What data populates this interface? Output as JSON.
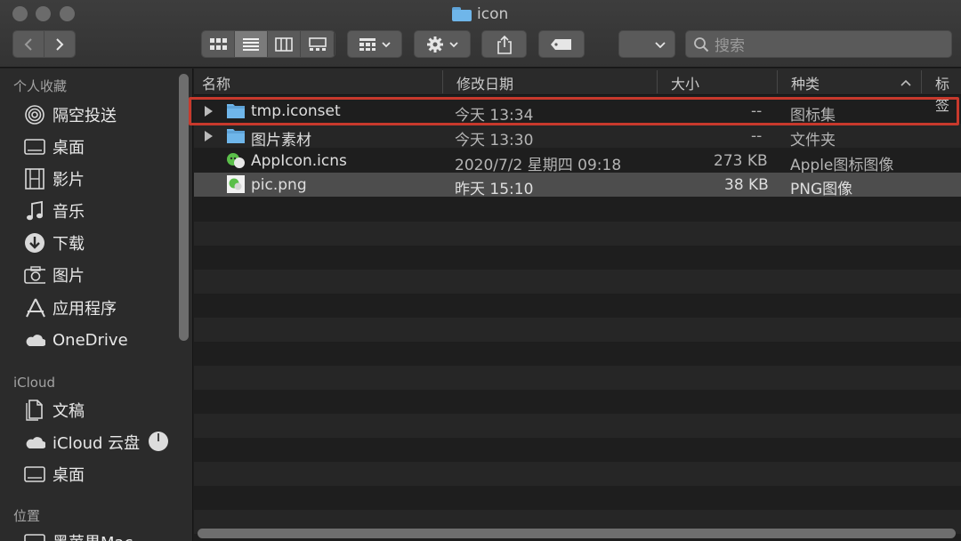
{
  "window": {
    "title": "icon"
  },
  "toolbar": {
    "search_placeholder": "搜索"
  },
  "sidebar": {
    "favorites_label": "个人收藏",
    "favorites": [
      {
        "label": "隔空投送",
        "icon": "airdrop-icon"
      },
      {
        "label": "桌面",
        "icon": "desktop-icon"
      },
      {
        "label": "影片",
        "icon": "film-icon"
      },
      {
        "label": "音乐",
        "icon": "music-icon"
      },
      {
        "label": "下载",
        "icon": "download-icon"
      },
      {
        "label": "图片",
        "icon": "camera-icon"
      },
      {
        "label": "应用程序",
        "icon": "applications-icon"
      },
      {
        "label": "OneDrive",
        "icon": "cloud-icon"
      }
    ],
    "icloud_label": "iCloud",
    "icloud": [
      {
        "label": "文稿",
        "icon": "documents-icon"
      },
      {
        "label": "iCloud 云盘",
        "icon": "cloud-icon"
      },
      {
        "label": "桌面",
        "icon": "desktop-icon"
      }
    ],
    "locations_label": "位置",
    "locations_partial": "黑苹果Mac"
  },
  "columns": {
    "name": "名称",
    "modified": "修改日期",
    "size": "大小",
    "kind": "种类",
    "tags": "标签"
  },
  "files": [
    {
      "name": "tmp.iconset",
      "modified": "今天 13:34",
      "size": "--",
      "kind": "图标集",
      "icon": "folder-icon",
      "expandable": true
    },
    {
      "name": "图片素材",
      "modified": "今天 13:30",
      "size": "--",
      "kind": "文件夹",
      "icon": "folder-icon",
      "expandable": true
    },
    {
      "name": "AppIcon.icns",
      "modified": "2020/7/2 星期四 09:18",
      "size": "273 KB",
      "kind": "Apple图标图像",
      "icon": "icns-file-icon",
      "expandable": false
    },
    {
      "name": "pic.png",
      "modified": "昨天 15:10",
      "size": "38 KB",
      "kind": "PNG图像",
      "icon": "png-file-icon",
      "expandable": false
    }
  ],
  "colors": {
    "highlight": "#c8392c",
    "folder": "#6fb6ea",
    "selection": "#4d4d4d"
  }
}
